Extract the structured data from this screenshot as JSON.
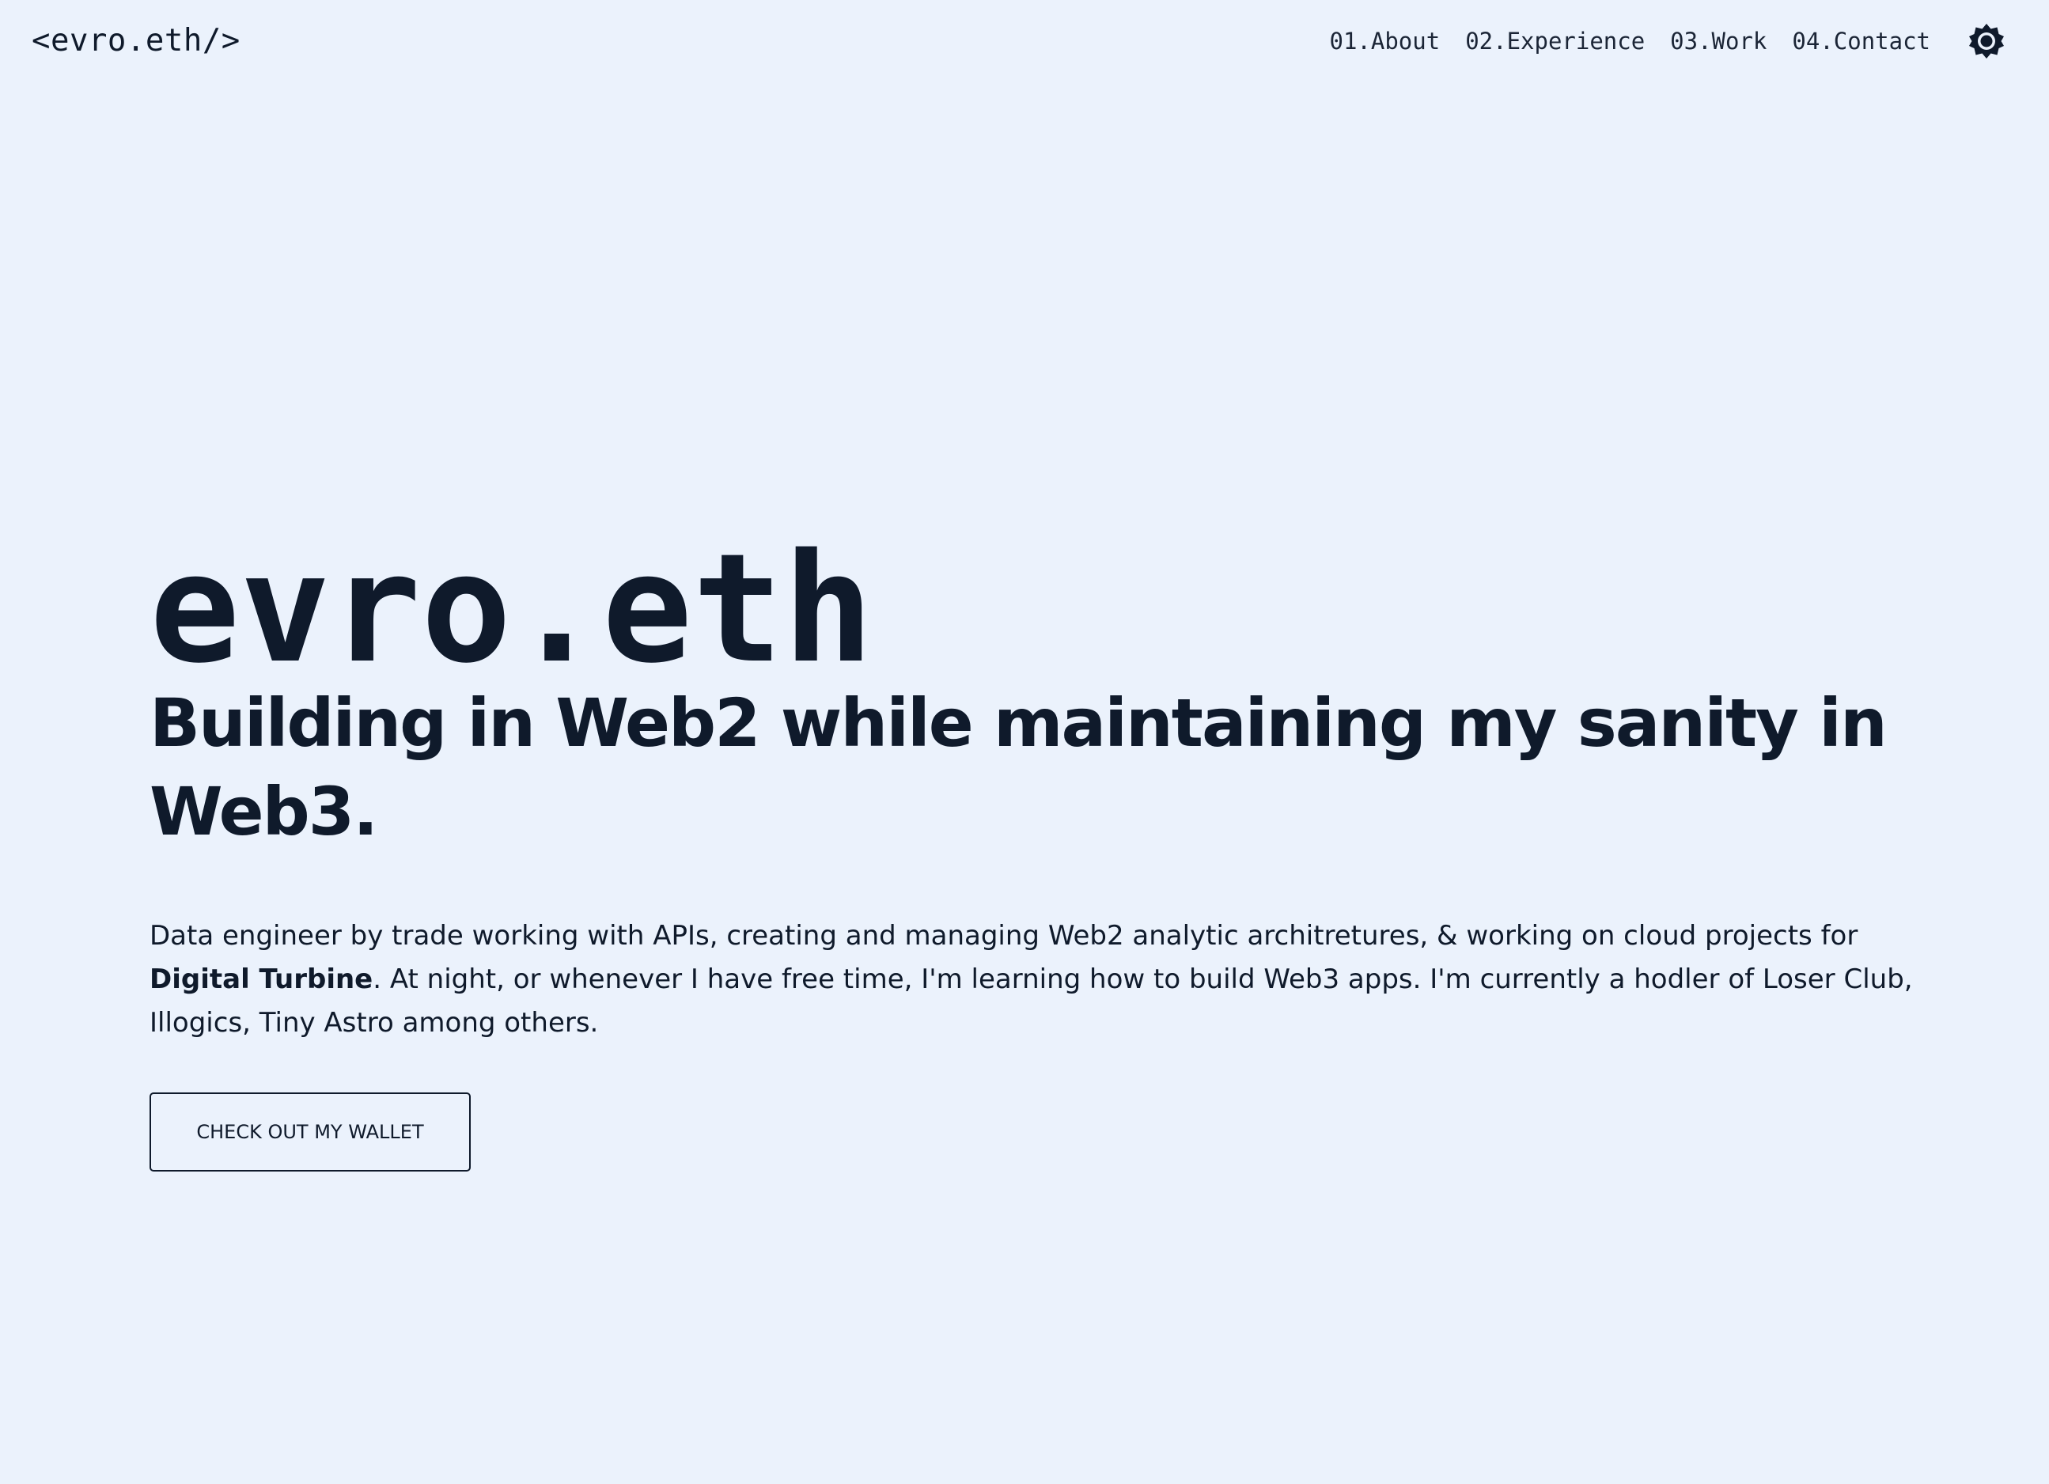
{
  "nav": {
    "logo": "<evro.eth/>",
    "links": [
      {
        "label": "01.About"
      },
      {
        "label": "02.Experience"
      },
      {
        "label": "03.Work"
      },
      {
        "label": "04.Contact"
      }
    ],
    "theme_toggle_icon": "sun-icon"
  },
  "hero": {
    "name": "evro.eth",
    "tagline": "Building in Web2 while maintaining my sanity in Web3.",
    "bio": {
      "part1": "Data engineer by trade working with APIs, creating and managing Web2 analytic architretures, & working on cloud projects for ",
      "company": "Digital Turbine",
      "part2": ". At night, or whenever I have free time, I'm learning how to build Web3 apps. I'm currently a hodler of Loser Club, Illogics, Tiny Astro among others."
    },
    "cta_label": "CHECK OUT MY WALLET"
  },
  "colors": {
    "background": "#ebf2fc",
    "text": "#0f1a2b"
  }
}
